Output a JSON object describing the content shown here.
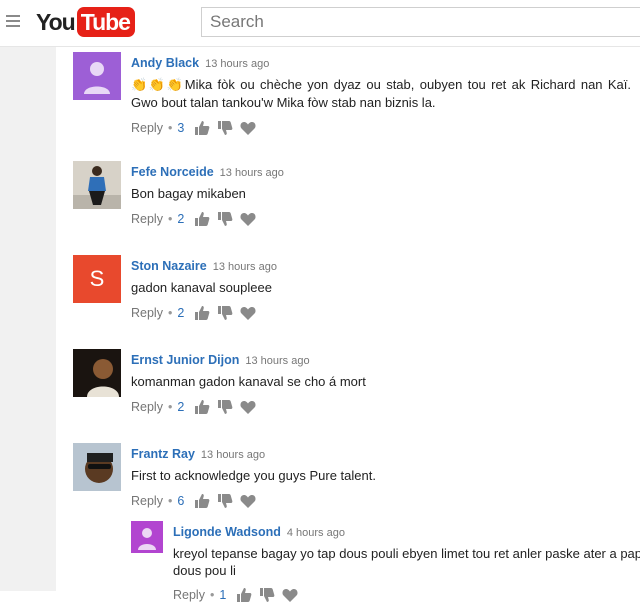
{
  "app": {
    "logo_you": "You",
    "logo_tube": "Tube",
    "search_placeholder": "Search"
  },
  "colors": {
    "accent_blue": "#2c6fb8",
    "brand_red": "#e62117"
  },
  "comments": [
    {
      "author": "Andy Black",
      "time": "13 hours ago",
      "text_prefix": "👏👏👏",
      "text": "Mika fòk ou chèche yon dyaz ou stab, oubyen tou ret ak Richard nan Kaï. Gwo bout talan tankou'w Mika fòw stab nan biznis la.",
      "reply": "Reply",
      "likes": "3",
      "avatar": "default-user-avatar"
    },
    {
      "author": "Fefe Norceide",
      "time": "13 hours ago",
      "text": "Bon bagay mikaben",
      "reply": "Reply",
      "likes": "2",
      "avatar": "photo-avatar"
    },
    {
      "author": "Ston Nazaire",
      "time": "13 hours ago",
      "text": "gadon kanaval soupleee",
      "reply": "Reply",
      "likes": "2",
      "avatar_letter": "S"
    },
    {
      "author": "Ernst Junior Dijon",
      "time": "13 hours ago",
      "text": "komanman gadon kanaval se cho á mort",
      "reply": "Reply",
      "likes": "2",
      "avatar": "photo-avatar"
    },
    {
      "author": "Frantz Ray",
      "time": "13 hours ago",
      "text": "First to acknowledge you guys Pure talent.",
      "reply": "Reply",
      "likes": "6",
      "avatar": "photo-avatar"
    }
  ],
  "reply_comment": {
    "author": "Ligonde Wadsond",
    "time": "4 hours ago",
    "text": "kreyol tepanse bagay yo tap dous pouli ebyen limet tou ret anler paske ater a pap dous pou li",
    "reply": "Reply",
    "likes": "1",
    "avatar": "default-user-avatar"
  }
}
